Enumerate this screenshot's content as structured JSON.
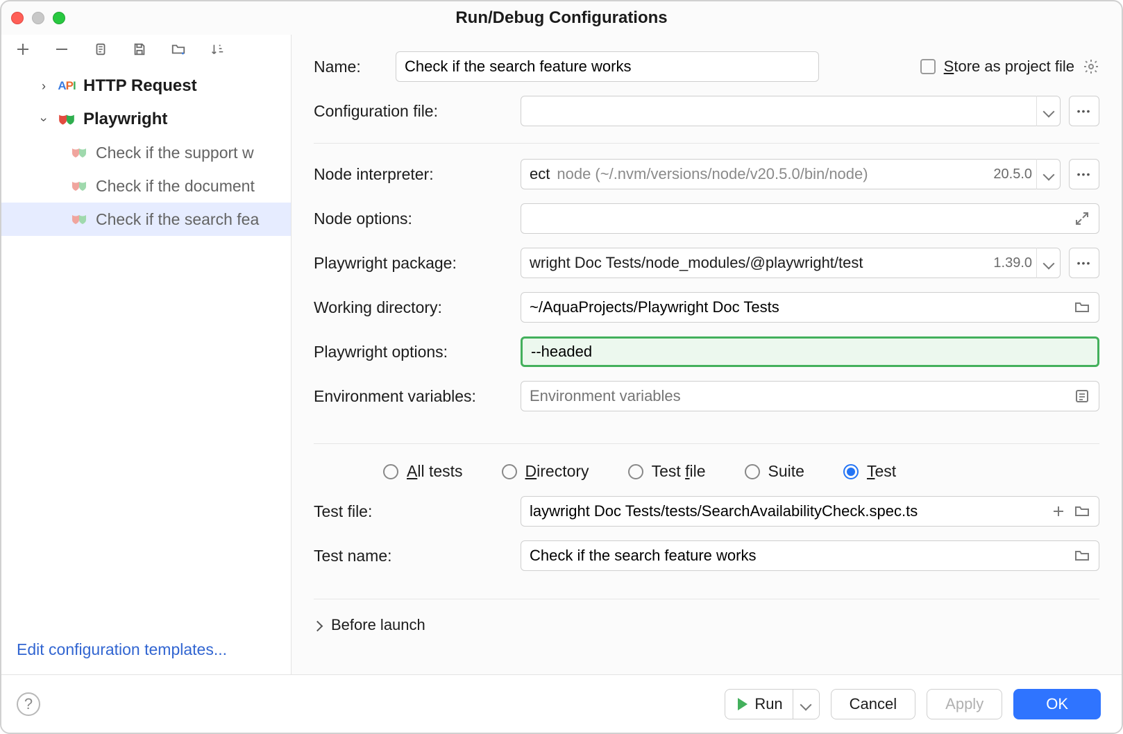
{
  "window": {
    "title": "Run/Debug Configurations"
  },
  "sidebar": {
    "items": [
      {
        "label": "HTTP Request",
        "expanded": false,
        "icon": "api"
      },
      {
        "label": "Playwright",
        "expanded": true,
        "icon": "mask",
        "children": [
          {
            "label": "Check if the support w"
          },
          {
            "label": "Check if the document"
          },
          {
            "label": "Check if the search fea",
            "selected": true
          }
        ]
      }
    ],
    "footer_link": "Edit configuration templates..."
  },
  "form": {
    "name_label": "Name:",
    "name_value": "Check if the search feature works",
    "store_label": "Store as project file",
    "config_file_label": "Configuration file:",
    "config_file_value": "",
    "node_interpreter_label": "Node interpreter:",
    "node_interpreter_prefix": "ect",
    "node_interpreter_value": "node (~/.nvm/versions/node/v20.5.0/bin/node)",
    "node_interpreter_version": "20.5.0",
    "node_options_label": "Node options:",
    "node_options_value": "",
    "playwright_pkg_label": "Playwright package:",
    "playwright_pkg_value": "wright Doc Tests/node_modules/@playwright/test",
    "playwright_pkg_version": "1.39.0",
    "workdir_label": "Working directory:",
    "workdir_value": "~/AquaProjects/Playwright Doc Tests",
    "playwright_opts_label": "Playwright options:",
    "playwright_opts_value": "--headed",
    "env_label": "Environment variables:",
    "env_placeholder": "Environment variables",
    "radio": {
      "all": "All tests",
      "directory": "Directory",
      "testfile": "Test file",
      "suite": "Suite",
      "test": "Test",
      "selected": "test"
    },
    "testfile_label": "Test file:",
    "testfile_value": "laywright Doc Tests/tests/SearchAvailabilityCheck.spec.ts",
    "testname_label": "Test name:",
    "testname_value": "Check if the search feature works",
    "before_launch_label": "Before launch"
  },
  "footer": {
    "run": "Run",
    "cancel": "Cancel",
    "apply": "Apply",
    "ok": "OK"
  }
}
